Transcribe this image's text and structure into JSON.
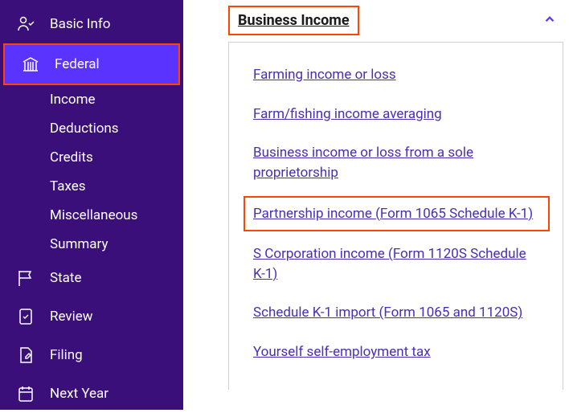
{
  "sidebar": {
    "items": [
      {
        "label": "Basic Info"
      },
      {
        "label": "Federal"
      },
      {
        "label": "State"
      },
      {
        "label": "Review"
      },
      {
        "label": "Filing"
      },
      {
        "label": "Next Year"
      }
    ],
    "subitems": [
      {
        "label": "Income"
      },
      {
        "label": "Deductions"
      },
      {
        "label": "Credits"
      },
      {
        "label": "Taxes"
      },
      {
        "label": "Miscellaneous"
      },
      {
        "label": "Summary"
      }
    ]
  },
  "main": {
    "accordion_title": "Business Income",
    "links": [
      {
        "label": "Farming income or loss"
      },
      {
        "label": "Farm/fishing income averaging"
      },
      {
        "label": "Business income or loss from a sole proprietorship"
      },
      {
        "label": "Partnership income (Form 1065 Schedule K-1)"
      },
      {
        "label": "S Corporation income (Form 1120S Schedule K-1)"
      },
      {
        "label": "Schedule K-1 import (Form 1065 and 1120S)"
      },
      {
        "label": "Yourself self-employment tax"
      }
    ]
  }
}
